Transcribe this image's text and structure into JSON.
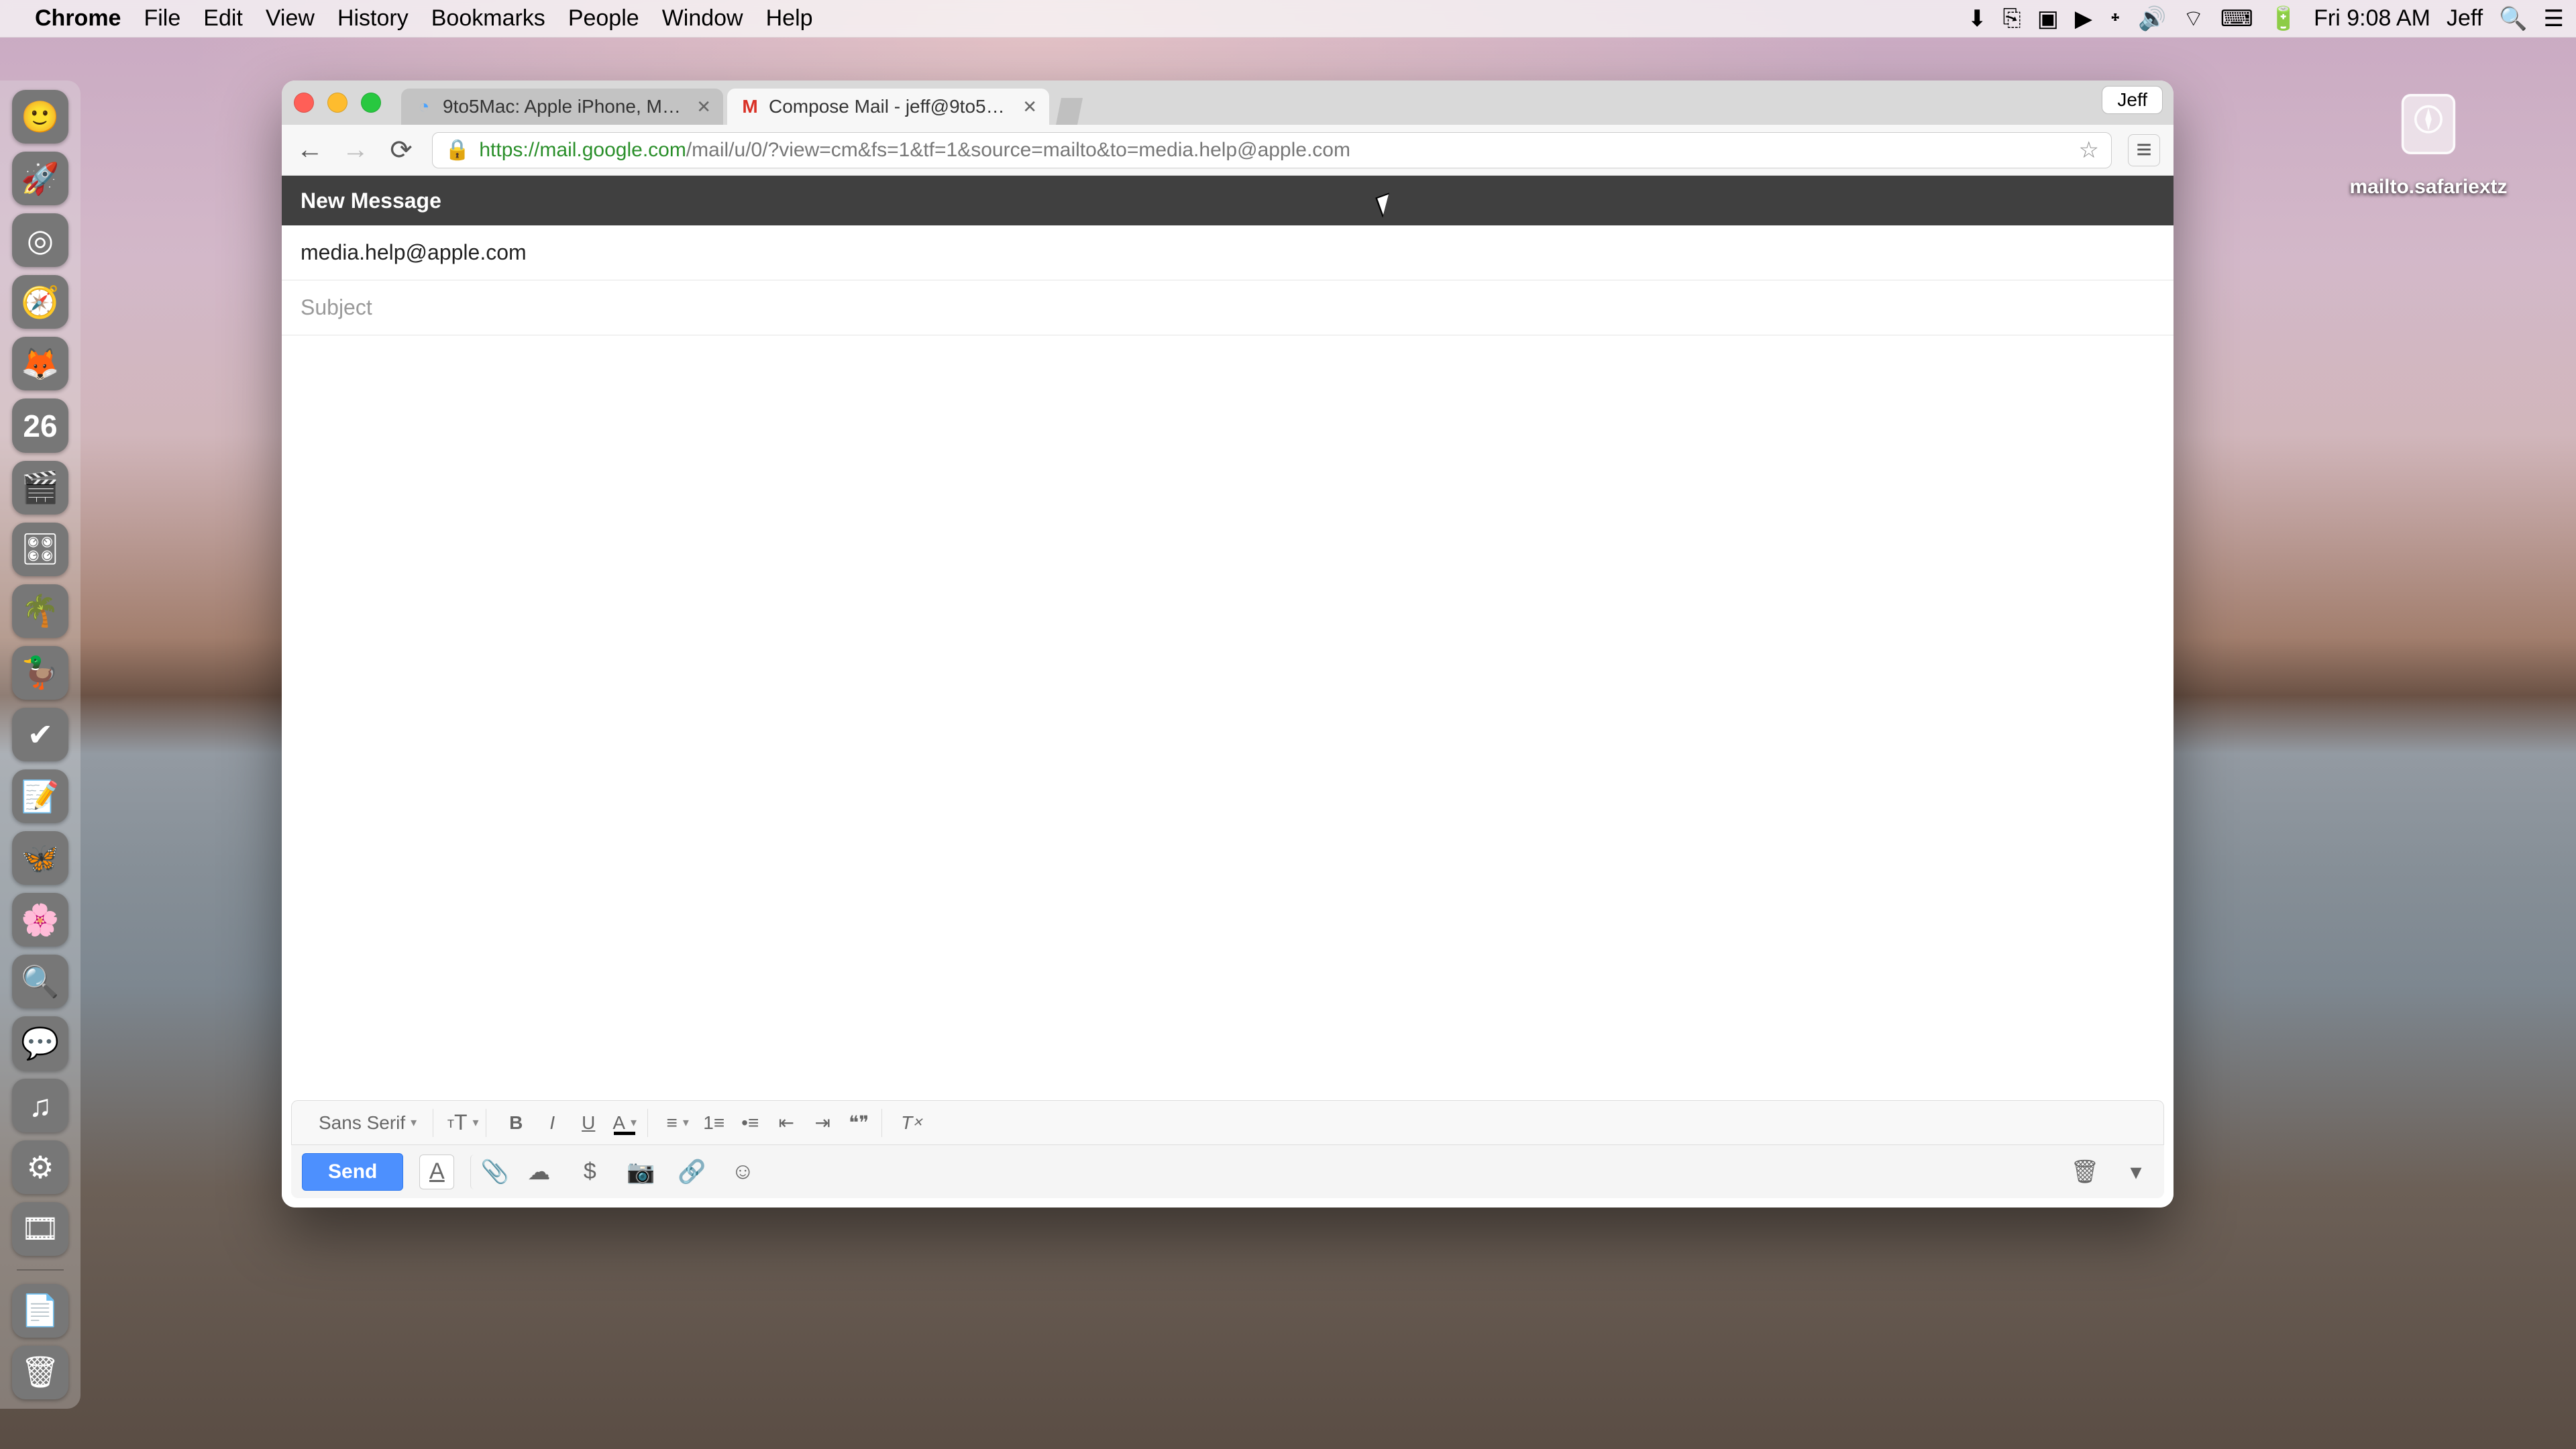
{
  "menubar": {
    "app_name": "Chrome",
    "items": [
      "File",
      "Edit",
      "View",
      "History",
      "Bookmarks",
      "People",
      "Window",
      "Help"
    ],
    "clock": "Fri 9:08 AM",
    "username": "Jeff"
  },
  "dock": {
    "items": [
      {
        "name": "finder",
        "glyph": "🙂"
      },
      {
        "name": "launchpad",
        "glyph": "🚀"
      },
      {
        "name": "chrome",
        "glyph": "◎"
      },
      {
        "name": "safari",
        "glyph": "🧭"
      },
      {
        "name": "firefox",
        "glyph": "🦊"
      },
      {
        "name": "calendar",
        "glyph": "26"
      },
      {
        "name": "final-cut-pro",
        "glyph": "🎬"
      },
      {
        "name": "logic-pro",
        "glyph": "🎛"
      },
      {
        "name": "iphoto",
        "glyph": "🌴"
      },
      {
        "name": "cyberduck",
        "glyph": "🦆"
      },
      {
        "name": "things",
        "glyph": "✔"
      },
      {
        "name": "notes",
        "glyph": "📝"
      },
      {
        "name": "butterfly",
        "glyph": "🦋"
      },
      {
        "name": "photos",
        "glyph": "🌸"
      },
      {
        "name": "detectx",
        "glyph": "🔍"
      },
      {
        "name": "messages",
        "glyph": "💬"
      },
      {
        "name": "itunes",
        "glyph": "♫"
      },
      {
        "name": "system-preferences",
        "glyph": "⚙"
      },
      {
        "name": "quicktime",
        "glyph": "🎞"
      }
    ],
    "extras": [
      {
        "name": "downloads",
        "glyph": "📄"
      },
      {
        "name": "trash",
        "glyph": "🗑"
      }
    ]
  },
  "desktop": {
    "file_label": "mailto.safariextz"
  },
  "chrome": {
    "profile_badge": "Jeff",
    "tabs": [
      {
        "title": "9to5Mac: Apple iPhone, M…",
        "favicon": "◔",
        "active": false
      },
      {
        "title": "Compose Mail - jeff@9to5…",
        "favicon": "M",
        "active": true
      }
    ],
    "url_host": "https://mail.google.com",
    "url_path": "/mail/u/0/?view=cm&fs=1&tf=1&source=mailto&to=media.help@apple.com"
  },
  "compose": {
    "header": "New Message",
    "to": "media.help@apple.com",
    "subject_placeholder": "Subject",
    "font_label": "Sans Serif",
    "send_label": "Send"
  }
}
